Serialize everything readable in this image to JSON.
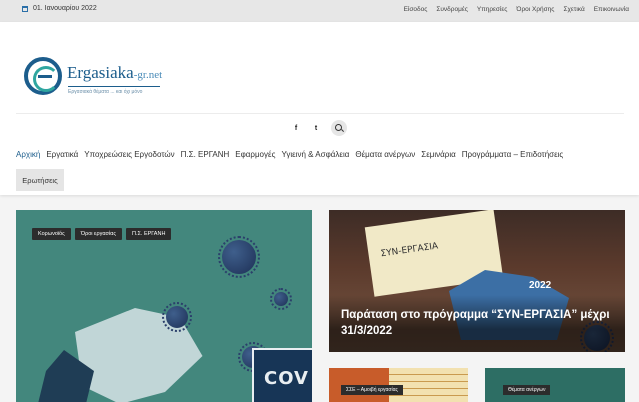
{
  "topbar": {
    "date": "01. Ιανουαρίου 2022",
    "links": [
      "Είσοδος",
      "Συνδρομές",
      "Υπηρεσίες",
      "Όροι Χρήσης",
      "Σχετικά",
      "Επικοινωνία"
    ]
  },
  "logo": {
    "name": "Ergasiaka",
    "suffix": "-gr.net",
    "tagline": "Εργασιακά θέματα ... και όχι μόνο"
  },
  "social": {
    "facebook": "f",
    "twitter": "t"
  },
  "nav": {
    "items": [
      "Αρχική",
      "Εργατικά",
      "Υποχρεώσεις Εργοδοτών",
      "Π.Σ. ΕΡΓΑΝΗ",
      "Εφαρμογές",
      "Υγιεινή & Ασφάλεια",
      "Θέματα ανέργων",
      "Σεμινάρια",
      "Προγράμματα – Επιδοτήσεις"
    ],
    "second_row": "Ερωτήσεις"
  },
  "left_card": {
    "tags": [
      "Κορωνοϊός",
      "Όροι εργασίας",
      "Π.Σ. ΕΡΓΑΝΗ"
    ],
    "image_text": "COV"
  },
  "right_card": {
    "image_text": "ΣΥΝ-ΕΡΓΑΣΙΑ",
    "year": "2022",
    "title": "Παράταση στο πρόγραμμα “ΣΥΝ-ΕΡΓΑΣΙΑ” μέχρι 31/3/2022"
  },
  "small_cards": {
    "first_tag": "ΣΣΕ – Αμοιβή εργασίας",
    "second_tag": "Θέματα ανέργων"
  },
  "colors": {
    "accent": "#1c5d8c",
    "teal": "#2fa6a0"
  }
}
